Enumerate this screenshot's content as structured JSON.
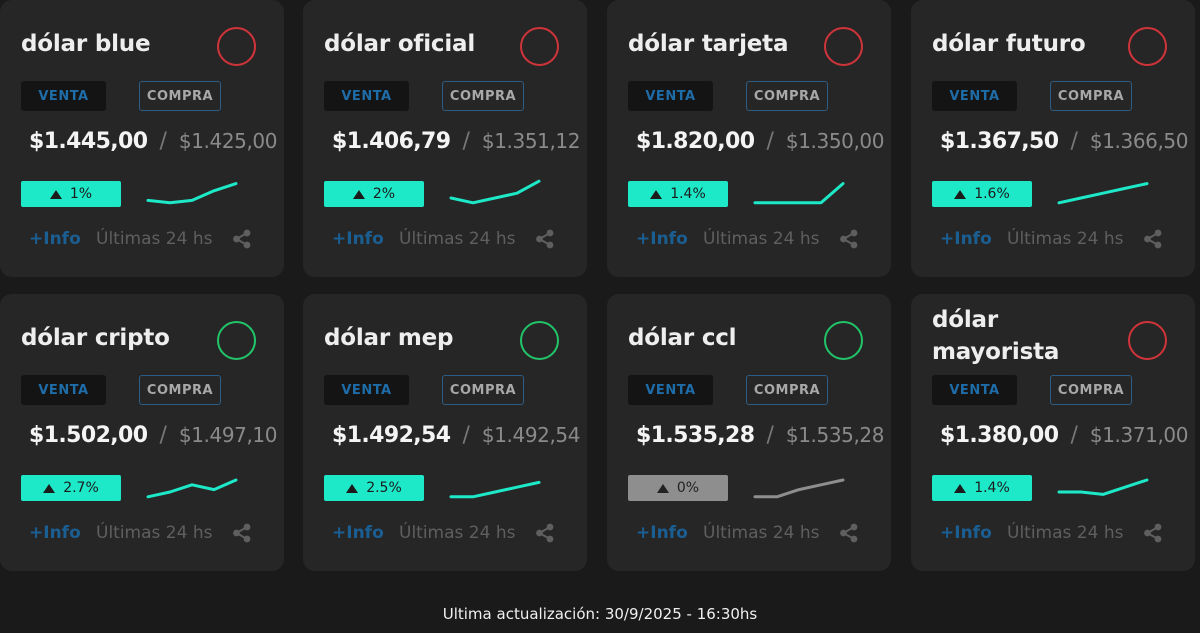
{
  "cards": [
    {
      "title": "dólar blue",
      "venta_label": "VENTA",
      "compra_label": "COMPRA",
      "venta": "$1.445,00",
      "compra": "$1.425,00",
      "change": "1%",
      "status": "red",
      "trend": "up",
      "sparkline": [
        4,
        3,
        4,
        8,
        11
      ],
      "info_label": "+Info",
      "period_label": "Últimas 24 hs",
      "share_icon": "share-icon"
    },
    {
      "title": "dólar oficial",
      "venta_label": "VENTA",
      "compra_label": "COMPRA",
      "venta": "$1.406,79",
      "compra": "$1.351,12",
      "change": "2%",
      "status": "red",
      "trend": "up",
      "sparkline": [
        5,
        3,
        5,
        7,
        12
      ],
      "info_label": "+Info",
      "period_label": "Últimas 24 hs",
      "share_icon": "share-icon"
    },
    {
      "title": "dólar tarjeta",
      "venta_label": "VENTA",
      "compra_label": "COMPRA",
      "venta": "$1.820,00",
      "compra": "$1.350,00",
      "change": "1.4%",
      "status": "red",
      "trend": "up",
      "sparkline": [
        3,
        3,
        3,
        3,
        11
      ],
      "info_label": "+Info",
      "period_label": "Últimas 24 hs",
      "share_icon": "share-icon"
    },
    {
      "title": "dólar futuro",
      "venta_label": "VENTA",
      "compra_label": "COMPRA",
      "venta": "$1.367,50",
      "compra": "$1.366,50",
      "change": "1.6%",
      "status": "red",
      "trend": "up",
      "sparkline": [
        3,
        5,
        7,
        9,
        11
      ],
      "info_label": "+Info",
      "period_label": "Últimas 24 hs",
      "share_icon": "share-icon"
    },
    {
      "title": "dólar cripto",
      "venta_label": "VENTA",
      "compra_label": "COMPRA",
      "venta": "$1.502,00",
      "compra": "$1.497,10",
      "change": "2.7%",
      "status": "green",
      "trend": "up",
      "sparkline": [
        3,
        5,
        8,
        6,
        10
      ],
      "info_label": "+Info",
      "period_label": "Últimas 24 hs",
      "share_icon": "share-icon"
    },
    {
      "title": "dólar mep",
      "venta_label": "VENTA",
      "compra_label": "COMPRA",
      "venta": "$1.492,54",
      "compra": "$1.492,54",
      "change": "2.5%",
      "status": "green",
      "trend": "up",
      "sparkline": [
        3,
        3,
        5,
        7,
        9
      ],
      "info_label": "+Info",
      "period_label": "Últimas 24 hs",
      "share_icon": "share-icon"
    },
    {
      "title": "dólar ccl",
      "venta_label": "VENTA",
      "compra_label": "COMPRA",
      "venta": "$1.535,28",
      "compra": "$1.535,28",
      "change": "0%",
      "status": "green",
      "trend": "flat",
      "sparkline": [
        3,
        3,
        6,
        8,
        10
      ],
      "info_label": "+Info",
      "period_label": "Últimas 24 hs",
      "share_icon": "share-icon"
    },
    {
      "title": "dólar mayorista",
      "venta_label": "VENTA",
      "compra_label": "COMPRA",
      "venta": "$1.380,00",
      "compra": "$1.371,00",
      "change": "1.4%",
      "status": "red",
      "trend": "up",
      "sparkline": [
        5,
        5,
        4,
        7,
        10
      ],
      "info_label": "+Info",
      "period_label": "Últimas 24 hs",
      "share_icon": "share-icon"
    }
  ],
  "footer": {
    "updated": "Ultima actualización: 30/9/2025 - 16:30hs"
  },
  "colors": {
    "accent": "#1de9c9",
    "flat": "#8e8e8e",
    "red": "#d0343a",
    "green": "#22c46a",
    "venta": "#1e6ca8",
    "info": "#1a5e92"
  }
}
